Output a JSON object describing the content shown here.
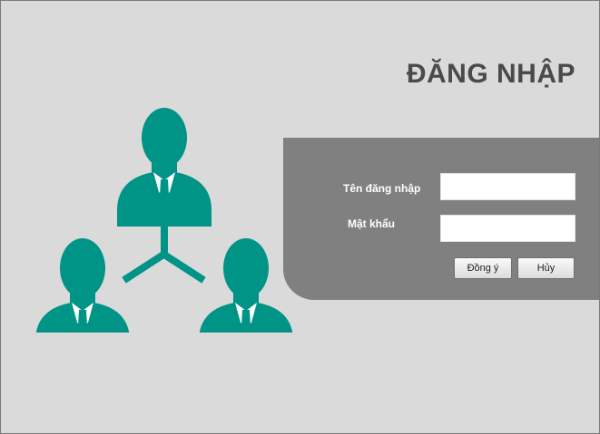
{
  "login": {
    "title": "ĐĂNG NHẬP",
    "username_label": "Tên đăng nhập",
    "username_value": "",
    "password_label": "Mật khẩu",
    "password_value": "",
    "ok_button": "Đồng ý",
    "cancel_button": "Hủy"
  },
  "illustration": {
    "icon": "users-network-icon",
    "color": "#009487"
  },
  "colors": {
    "background": "#dadada",
    "panel": "#808080",
    "title": "#4a4a4a"
  }
}
